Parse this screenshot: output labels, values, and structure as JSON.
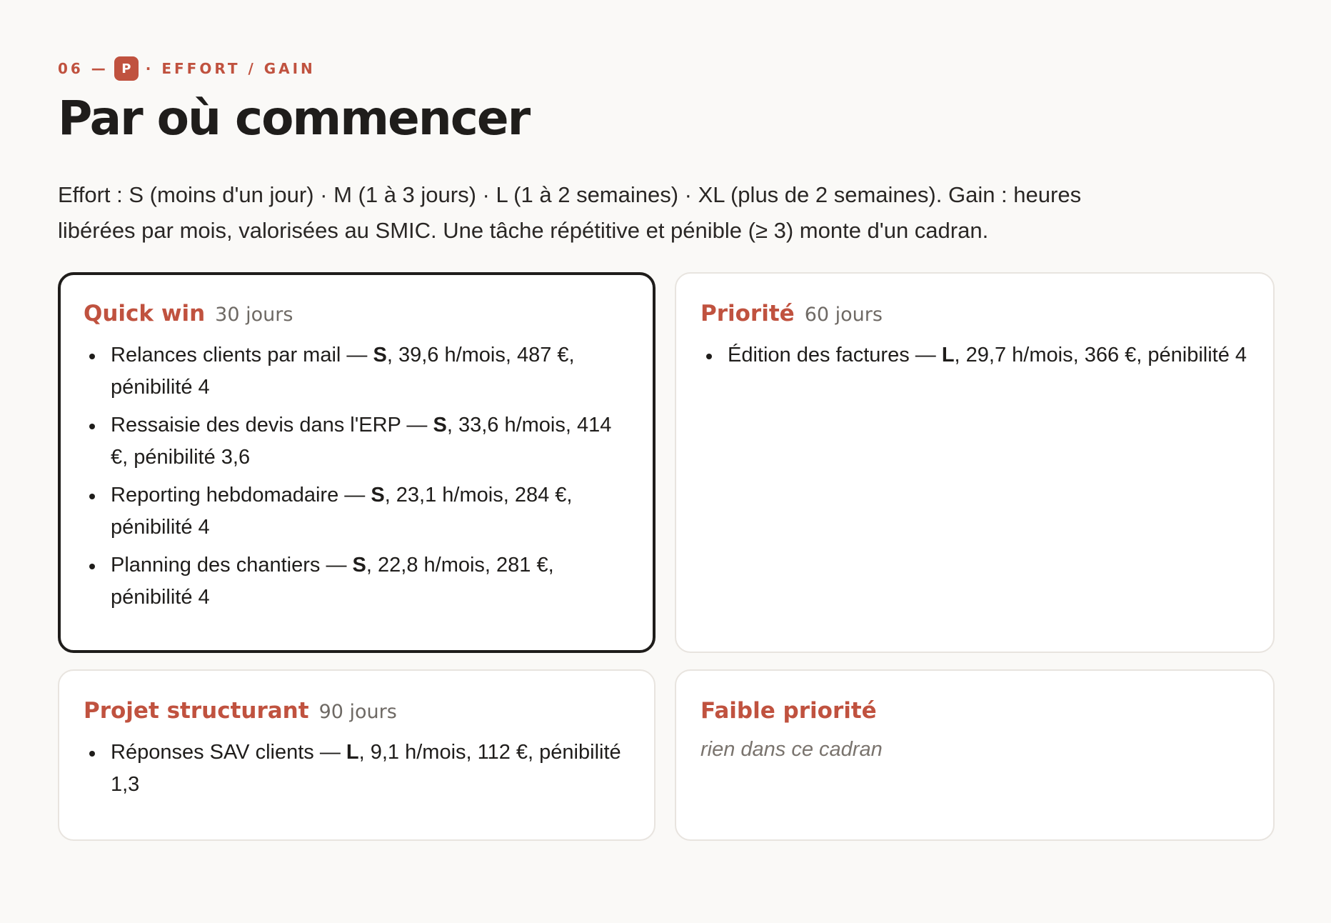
{
  "header": {
    "eyebrow_number": "06 —",
    "eyebrow_badge": "P",
    "eyebrow_label": "· EFFORT / GAIN",
    "title": "Par où commencer",
    "intro": "Effort : S (moins d'un jour) · M (1 à 3 jours) · L (1 à 2 semaines) · XL (plus de 2 semaines). Gain : heures libérées par mois, valorisées au SMIC. Une tâche répétitive et pénible (≥ 3) monte d'un cadran."
  },
  "quadrants": [
    {
      "title": "Quick win",
      "period": "30 jours",
      "highlighted": true,
      "items": [
        {
          "label": "Relances clients par mail —",
          "effort": "S",
          "details": ", 39,6 h/mois, 487 €, pénibilité 4"
        },
        {
          "label": "Ressaisie des devis dans l'ERP —",
          "effort": "S",
          "details": ", 33,6 h/mois, 414 €, pénibilité 3,6"
        },
        {
          "label": "Reporting hebdomadaire —",
          "effort": "S",
          "details": ", 23,1 h/mois, 284 €, pénibilité 4"
        },
        {
          "label": "Planning des chantiers —",
          "effort": "S",
          "details": ", 22,8 h/mois, 281 €, pénibilité 4"
        }
      ]
    },
    {
      "title": "Priorité",
      "period": "60 jours",
      "highlighted": false,
      "items": [
        {
          "label": "Édition des factures —",
          "effort": "L",
          "details": ", 29,7 h/mois, 366 €, pénibilité 4"
        }
      ]
    },
    {
      "title": "Projet structurant",
      "period": "90 jours",
      "highlighted": false,
      "items": [
        {
          "label": "Réponses SAV clients —",
          "effort": "L",
          "details": ", 9,1 h/mois, 112 €, pénibilité 1,3"
        }
      ]
    },
    {
      "title": "Faible priorité",
      "period": "",
      "highlighted": false,
      "items": [],
      "empty_text": "rien dans ce cadran"
    }
  ],
  "colors": {
    "accent": "#c0523f",
    "background": "#faf9f7",
    "card": "#ffffff",
    "text": "#1f1d1b",
    "muted": "#6e6964",
    "highlight_border": "#1f1d1b"
  }
}
